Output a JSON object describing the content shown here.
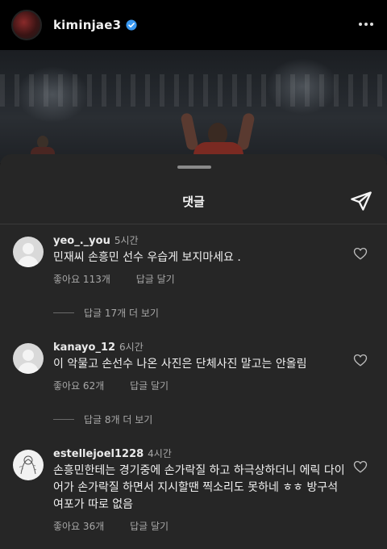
{
  "post": {
    "username": "kiminjae3",
    "verified_color": "#3897f0"
  },
  "sheet": {
    "title": "댓글"
  },
  "comments": [
    {
      "username": "yeo_._you",
      "time": "5시간",
      "text": "민재씨 손흥민 선수 우습게 보지마세요 .",
      "likes": "좋아요 113개",
      "reply_label": "답글 달기",
      "view_replies": "답글 17개 더 보기"
    },
    {
      "username": "kanayo_12",
      "time": "6시간",
      "text": "이 악물고 손선수 나온 사진은 단체사진 말고는 안올림",
      "likes": "좋아요 62개",
      "reply_label": "답글 달기",
      "view_replies": "답글 8개 더 보기"
    },
    {
      "username": "estellejoel1228",
      "time": "4시간",
      "text": "손흥민한테는 경기중에 손가락질 하고 하극상하더니 에릭 다이어가 손가락질 하면서 지시할땐 찍소리도 못하네 ㅎㅎ 방구석 여포가 따로 없음",
      "likes": "좋아요 36개",
      "reply_label": "답글 달기"
    }
  ],
  "icons": [
    "verified-badge",
    "more-icon",
    "share-icon",
    "heart-icon"
  ]
}
